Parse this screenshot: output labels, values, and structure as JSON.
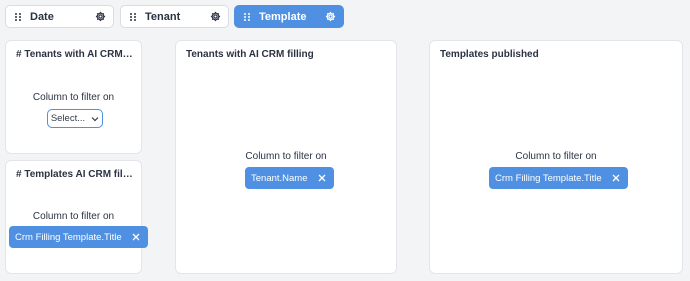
{
  "filters": [
    {
      "label": "Date",
      "active": false
    },
    {
      "label": "Tenant",
      "active": false
    },
    {
      "label": "Template",
      "active": true
    }
  ],
  "cards": {
    "tenants_count": {
      "title": "# Tenants with AI CRM filli...",
      "filter_label": "Column to filter on",
      "select_placeholder": "Select..."
    },
    "templates_count": {
      "title": "# Templates AI CRM filling ...",
      "filter_label": "Column to filter on",
      "column": "Crm Filling Template.Title"
    },
    "tenants_filling": {
      "title": "Tenants with AI CRM filling",
      "filter_label": "Column to filter on",
      "column": "Tenant.Name"
    },
    "templates_published": {
      "title": "Templates published",
      "filter_label": "Column to filter on",
      "column": "Crm Filling Template.Title"
    }
  },
  "colors": {
    "accent": "#4f90e2",
    "background": "#f3f4f6",
    "card": "#ffffff",
    "text": "#2b3343"
  },
  "icons": {
    "drag_handle": "grip-dots-icon",
    "settings": "gear-icon",
    "dropdown": "chevron-down-icon",
    "remove": "close-icon"
  }
}
